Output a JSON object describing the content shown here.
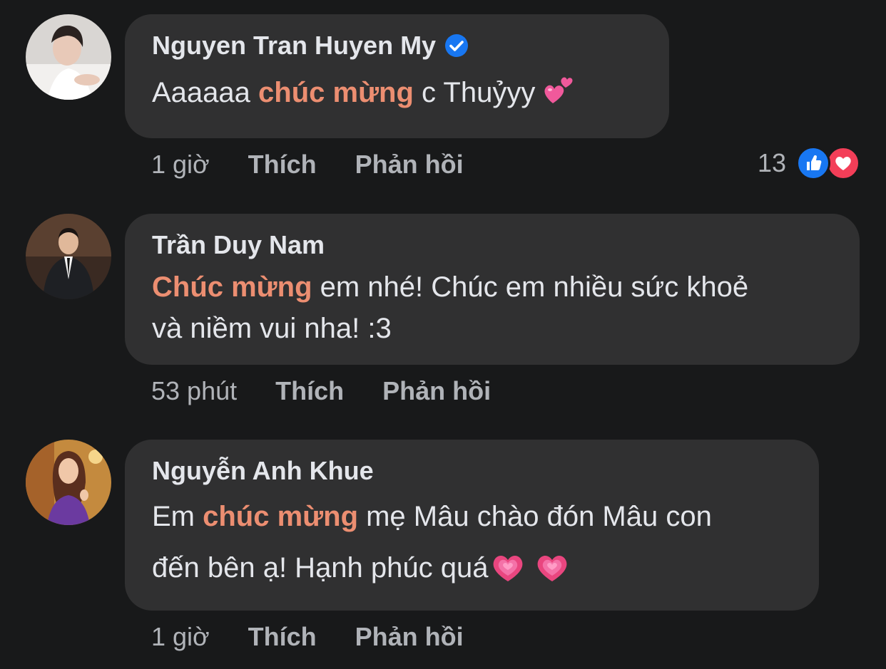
{
  "comments": [
    {
      "author": "Nguyen Tran Huyen My",
      "verified": true,
      "lines": [
        {
          "pre": "Aaaaaa ",
          "hl": "chúc mừng",
          "post": " c Thuỷyy "
        }
      ],
      "emoji": "two-hearts",
      "time": "1 giờ",
      "like": "Thích",
      "reply": "Phản hồi",
      "reaction_count": "13",
      "reactions": [
        "like",
        "love"
      ]
    },
    {
      "author": "Trần Duy Nam",
      "verified": false,
      "lines": [
        {
          "pre": "",
          "hl": "Chúc mừng",
          "post": " em nhé! Chúc em nhiều sức khoẻ"
        },
        {
          "pre": "và niềm vui nha! :3",
          "hl": "",
          "post": ""
        }
      ],
      "time": "53 phút",
      "like": "Thích",
      "reply": "Phản hồi"
    },
    {
      "author": "Nguyễn Anh Khue",
      "verified": false,
      "lines": [
        {
          "pre": "Em ",
          "hl": "chúc mừng",
          "post": " mẹ Mâu chào đón Mâu con"
        },
        {
          "pre": "đến bên ạ! Hạnh phúc quá",
          "hl": "",
          "post": ""
        }
      ],
      "emoji": "growing-hearts",
      "time": "1 giờ",
      "like": "Thích",
      "reply": "Phản hồi"
    }
  ],
  "colors": {
    "background": "#18191a",
    "bubble": "#303031",
    "highlight": "#ec8e71",
    "meta": "#b0b3b8",
    "like_blue": "#1877f2",
    "love_red": "#f33e58"
  }
}
